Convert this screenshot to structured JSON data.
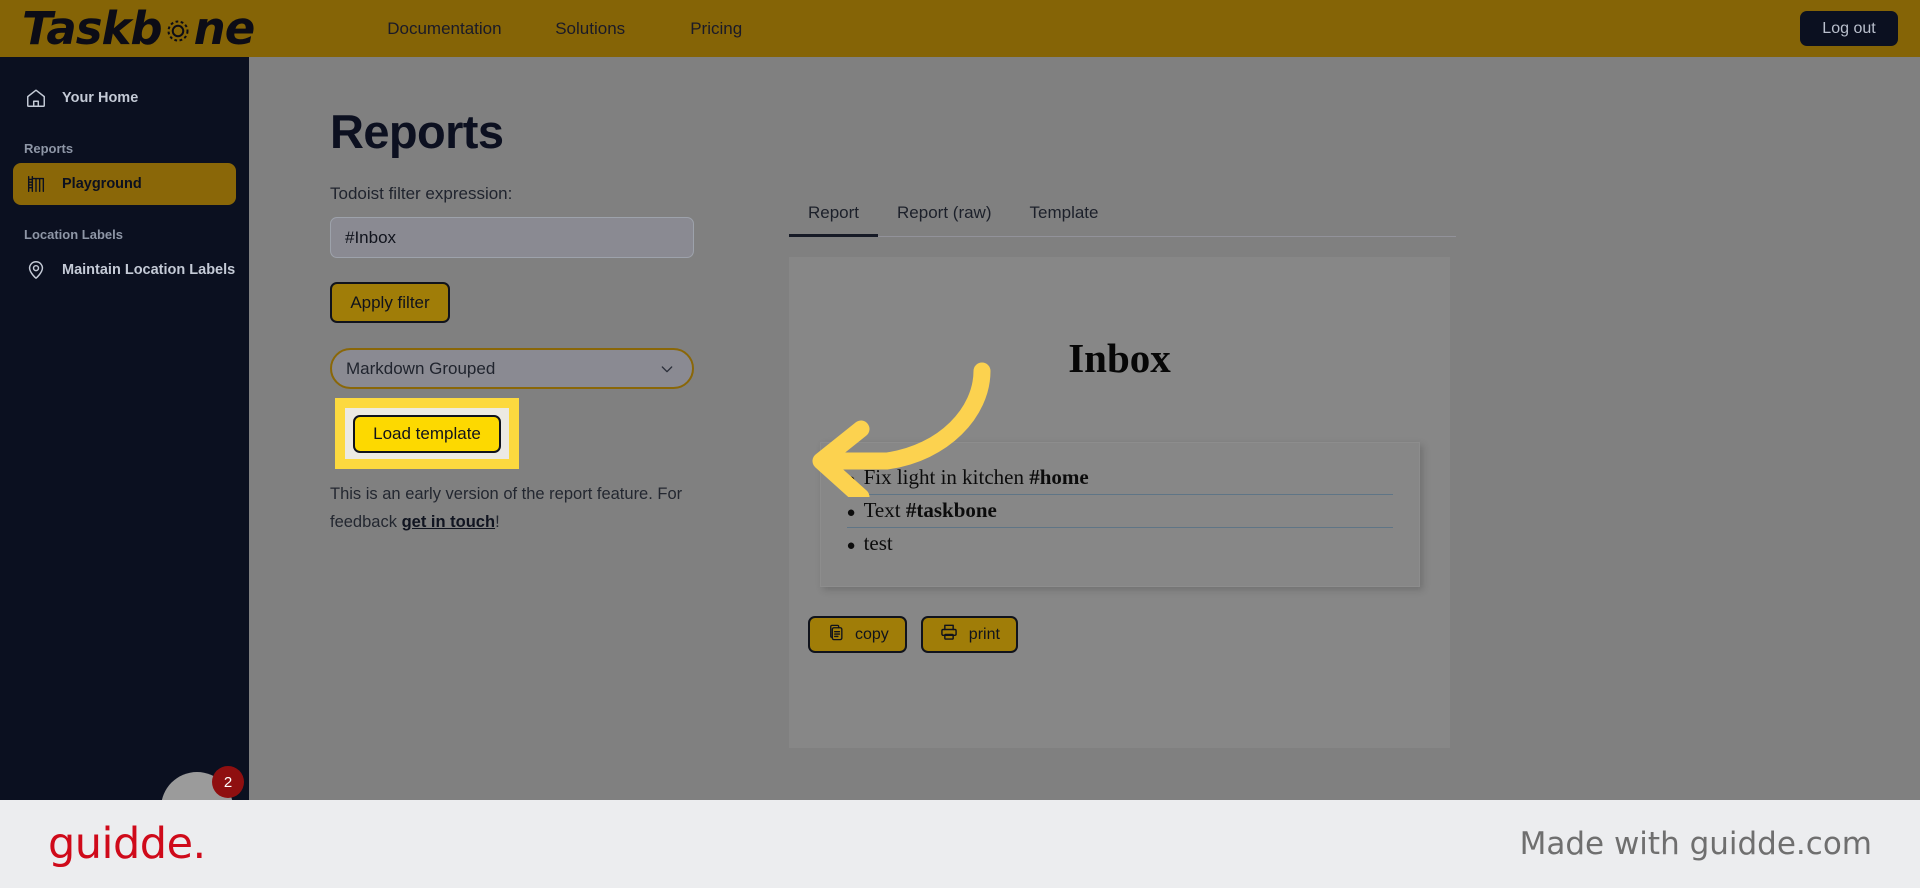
{
  "topnav": {
    "brand": "Taskb",
    "brand_suffix": "ne",
    "brand_icon": "gear-icon",
    "links": [
      {
        "label": "Documentation",
        "name": "nav-documentation"
      },
      {
        "label": "Solutions",
        "name": "nav-solutions"
      },
      {
        "label": "Pricing",
        "name": "nav-pricing"
      }
    ],
    "logout_label": "Log out"
  },
  "sidebar": {
    "home_label": "Your Home",
    "home_icon": "home-icon",
    "section_reports": "Reports",
    "playground_label": "Playground",
    "playground_icon": "playground-icon",
    "section_location_labels": "Location Labels",
    "maintain_label": "Maintain Location Labels",
    "maintain_icon": "map-pin-icon",
    "fab_badge_count": "2"
  },
  "main": {
    "page_title": "Reports",
    "filter_label": "Todoist filter expression:",
    "filter_value": "#Inbox",
    "filter_placeholder": "Todoist filter expression",
    "apply_filter_label": "Apply filter",
    "template_select_value": "Markdown Grouped",
    "load_template_label": "Load template",
    "feedback_text_before": "This is an early version of the report feature. For feedback ",
    "feedback_link": "get in touch",
    "feedback_text_after": "!"
  },
  "report": {
    "tabs": [
      {
        "label": "Report",
        "active": true
      },
      {
        "label": "Report (raw)",
        "active": false
      },
      {
        "label": "Template",
        "active": false
      }
    ],
    "title": "Inbox",
    "tasks": [
      {
        "bullet": "●",
        "text": "Fix light in kitchen ",
        "tag": "#home"
      },
      {
        "bullet": "●",
        "text": "Text ",
        "tag": "#taskbone"
      },
      {
        "bullet": "●",
        "text": "test",
        "tag": ""
      }
    ],
    "copy_label": "copy",
    "copy_icon": "clipboard-icon",
    "print_label": "print",
    "print_icon": "printer-icon"
  },
  "annotation": {
    "highlight_color": "#fcd93f",
    "arrow_color": "#fcd24f",
    "arrow_icon": "curved-left-arrow-icon"
  },
  "footer": {
    "logo_text": "guidde.",
    "made_with": "Made with guidde.com",
    "logo_color": "#cf0a1a"
  },
  "colors": {
    "brand_gold": "#856406",
    "sidebar_dark": "#0b1020",
    "accent_yellow": "#fdd900",
    "page_overlay_gray": "#808080"
  }
}
